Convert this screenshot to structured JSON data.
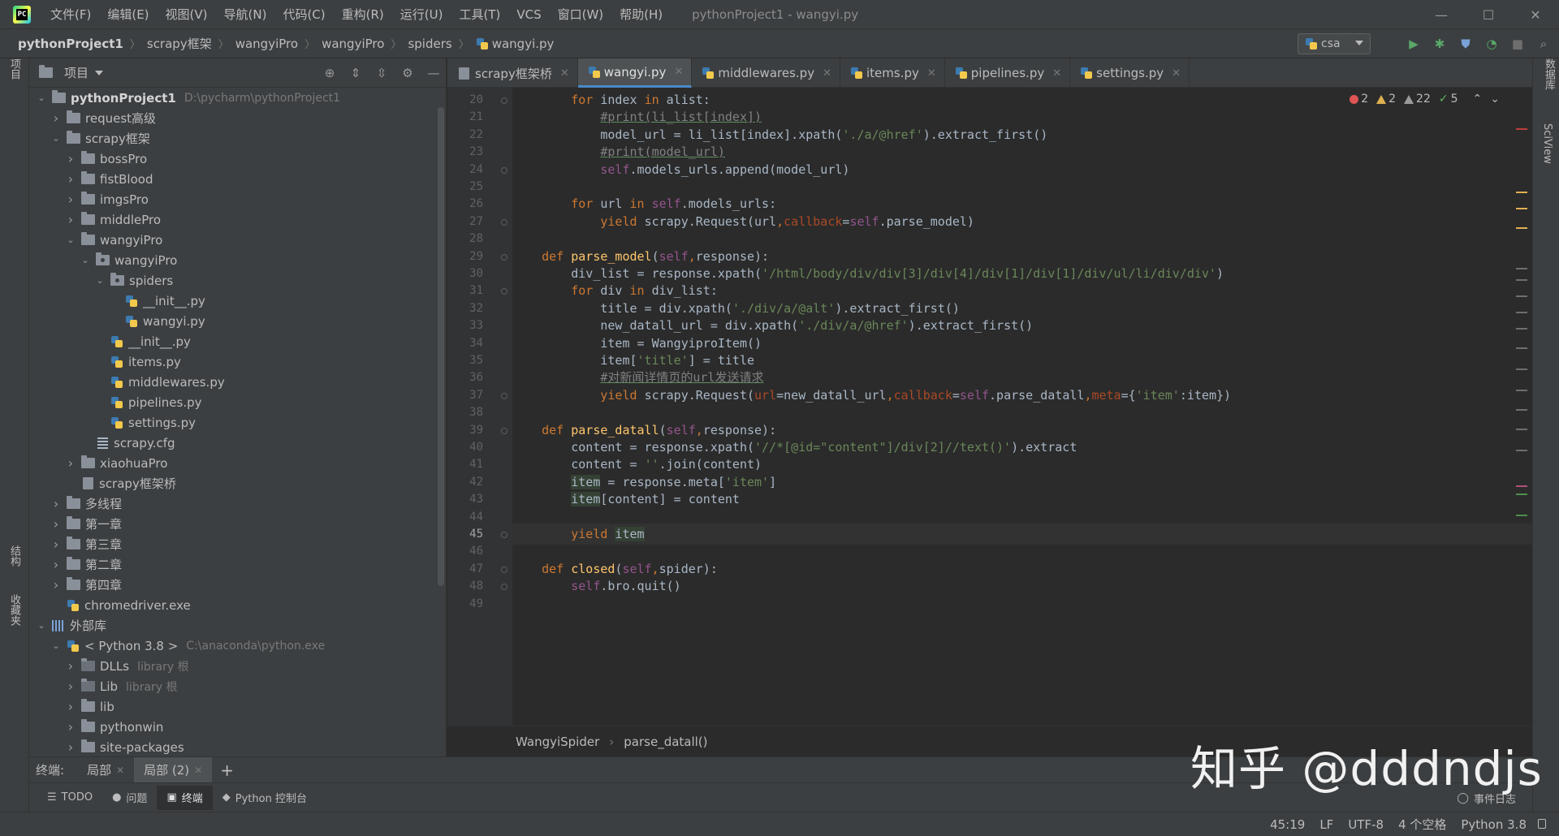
{
  "menubar": {
    "items": [
      "文件(F)",
      "编辑(E)",
      "视图(V)",
      "导航(N)",
      "代码(C)",
      "重构(R)",
      "运行(U)",
      "工具(T)",
      "VCS",
      "窗口(W)",
      "帮助(H)"
    ],
    "window_title": "pythonProject1 - wangyi.py"
  },
  "navbar": {
    "crumbs": [
      "pythonProject1",
      "scrapy框架",
      "wangyiPro",
      "wangyiPro",
      "spiders",
      "wangyi.py"
    ],
    "run_config": "csa"
  },
  "left_strip": {
    "project_tab": "项目",
    "structure_tab": "结构",
    "favorites_tab": "收藏夹"
  },
  "right_strip": {
    "database_tab": "数据库",
    "sciview_tab": "SciView"
  },
  "project_panel": {
    "title": "项目",
    "tree": [
      {
        "depth": 0,
        "arrow": "open",
        "icon": "folder",
        "label": "pythonProject1",
        "hint": "D:\\pycharm\\pythonProject1",
        "bold": true
      },
      {
        "depth": 1,
        "arrow": "closed",
        "icon": "folder",
        "label": "request高级"
      },
      {
        "depth": 1,
        "arrow": "open",
        "icon": "folder",
        "label": "scrapy框架"
      },
      {
        "depth": 2,
        "arrow": "closed",
        "icon": "folder",
        "label": "bossPro"
      },
      {
        "depth": 2,
        "arrow": "closed",
        "icon": "folder",
        "label": "fistBlood"
      },
      {
        "depth": 2,
        "arrow": "closed",
        "icon": "folder",
        "label": "imgsPro"
      },
      {
        "depth": 2,
        "arrow": "closed",
        "icon": "folder",
        "label": "middlePro"
      },
      {
        "depth": 2,
        "arrow": "open",
        "icon": "folder",
        "label": "wangyiPro"
      },
      {
        "depth": 3,
        "arrow": "open",
        "icon": "package",
        "label": "wangyiPro"
      },
      {
        "depth": 4,
        "arrow": "open",
        "icon": "package",
        "label": "spiders"
      },
      {
        "depth": 5,
        "arrow": "none",
        "icon": "python",
        "label": "__init__.py"
      },
      {
        "depth": 5,
        "arrow": "none",
        "icon": "python",
        "label": "wangyi.py"
      },
      {
        "depth": 4,
        "arrow": "none",
        "icon": "python",
        "label": "__init__.py"
      },
      {
        "depth": 4,
        "arrow": "none",
        "icon": "python",
        "label": "items.py"
      },
      {
        "depth": 4,
        "arrow": "none",
        "icon": "python",
        "label": "middlewares.py"
      },
      {
        "depth": 4,
        "arrow": "none",
        "icon": "python",
        "label": "pipelines.py"
      },
      {
        "depth": 4,
        "arrow": "none",
        "icon": "python",
        "label": "settings.py"
      },
      {
        "depth": 3,
        "arrow": "none",
        "icon": "config",
        "label": "scrapy.cfg"
      },
      {
        "depth": 2,
        "arrow": "closed",
        "icon": "folder",
        "label": "xiaohuaPro"
      },
      {
        "depth": 2,
        "arrow": "none",
        "icon": "file",
        "label": "scrapy框架桥"
      },
      {
        "depth": 1,
        "arrow": "closed",
        "icon": "folder",
        "label": "多线程"
      },
      {
        "depth": 1,
        "arrow": "closed",
        "icon": "folder",
        "label": "第一章"
      },
      {
        "depth": 1,
        "arrow": "closed",
        "icon": "folder",
        "label": "第三章"
      },
      {
        "depth": 1,
        "arrow": "closed",
        "icon": "folder",
        "label": "第二章"
      },
      {
        "depth": 1,
        "arrow": "closed",
        "icon": "folder",
        "label": "第四章"
      },
      {
        "depth": 1,
        "arrow": "none",
        "icon": "python",
        "label": "chromedriver.exe"
      },
      {
        "depth": 0,
        "arrow": "open",
        "icon": "library",
        "label": "外部库"
      },
      {
        "depth": 1,
        "arrow": "open",
        "icon": "python",
        "label": "< Python 3.8 >",
        "hint": "C:\\anaconda\\python.exe"
      },
      {
        "depth": 2,
        "arrow": "closed",
        "icon": "libfolder",
        "label": "DLLs",
        "hint": "library 根"
      },
      {
        "depth": 2,
        "arrow": "closed",
        "icon": "libfolder",
        "label": "Lib",
        "hint": "library 根"
      },
      {
        "depth": 2,
        "arrow": "closed",
        "icon": "folder",
        "label": "lib"
      },
      {
        "depth": 2,
        "arrow": "closed",
        "icon": "folder",
        "label": "pythonwin"
      },
      {
        "depth": 2,
        "arrow": "closed",
        "icon": "folder",
        "label": "site-packages"
      }
    ]
  },
  "editor": {
    "tabs": [
      {
        "label": "scrapy框架桥",
        "icon": "file",
        "active": false
      },
      {
        "label": "wangyi.py",
        "icon": "python",
        "active": true
      },
      {
        "label": "middlewares.py",
        "icon": "python",
        "active": false
      },
      {
        "label": "items.py",
        "icon": "python",
        "active": false
      },
      {
        "label": "pipelines.py",
        "icon": "python",
        "active": false
      },
      {
        "label": "settings.py",
        "icon": "python",
        "active": false
      }
    ],
    "inspections": {
      "errors": "2",
      "warnings": "2",
      "weak_warnings": "22",
      "ok": "5"
    },
    "current_line": 45,
    "lines": [
      {
        "n": 20,
        "tokens": [
          [
            "",
            "        "
          ],
          [
            "kw",
            "for "
          ],
          [
            "",
            "index "
          ],
          [
            "kw",
            "in "
          ],
          [
            "",
            "alist:"
          ]
        ]
      },
      {
        "n": 21,
        "tokens": [
          [
            "",
            "            "
          ],
          [
            "cm",
            "#print(li_list[index])"
          ]
        ]
      },
      {
        "n": 22,
        "tokens": [
          [
            "",
            "            model_url = li_list[index].xpath("
          ],
          [
            "st",
            "'./a/@href'"
          ],
          [
            "",
            ").extract_first()"
          ]
        ]
      },
      {
        "n": 23,
        "tokens": [
          [
            "",
            "            "
          ],
          [
            "cm",
            "#print(model_url)"
          ]
        ]
      },
      {
        "n": 24,
        "tokens": [
          [
            "",
            "            "
          ],
          [
            "se",
            "self"
          ],
          [
            "",
            ".models_urls.append(model_url)"
          ]
        ]
      },
      {
        "n": 25,
        "tokens": [
          [
            "",
            ""
          ]
        ]
      },
      {
        "n": 26,
        "tokens": [
          [
            "",
            "        "
          ],
          [
            "kw",
            "for "
          ],
          [
            "",
            "url "
          ],
          [
            "kw",
            "in "
          ],
          [
            "se",
            "self"
          ],
          [
            "",
            ".models_urls:"
          ]
        ]
      },
      {
        "n": 27,
        "tokens": [
          [
            "",
            "            "
          ],
          [
            "kw",
            "yield "
          ],
          [
            "",
            "scrapy.Request(url"
          ],
          [
            "kw",
            ","
          ],
          [
            "pa",
            "callback"
          ],
          [
            "",
            "="
          ],
          [
            "se",
            "self"
          ],
          [
            "",
            ".parse_model)"
          ]
        ]
      },
      {
        "n": 28,
        "tokens": [
          [
            "",
            ""
          ]
        ]
      },
      {
        "n": 29,
        "tokens": [
          [
            "",
            "    "
          ],
          [
            "kw",
            "def "
          ],
          [
            "fn",
            "parse_model"
          ],
          [
            "",
            "("
          ],
          [
            "se",
            "self"
          ],
          [
            "kw",
            ","
          ],
          [
            "",
            "response):"
          ]
        ]
      },
      {
        "n": 30,
        "tokens": [
          [
            "",
            "        div_list = response.xpath("
          ],
          [
            "st",
            "'/html/body/div/div[3]/div[4]/div[1]/div[1]/div/ul/li/div/div'"
          ],
          [
            "",
            ")"
          ]
        ]
      },
      {
        "n": 31,
        "tokens": [
          [
            "",
            "        "
          ],
          [
            "kw",
            "for "
          ],
          [
            "",
            "div "
          ],
          [
            "kw",
            "in "
          ],
          [
            "",
            "div_list:"
          ]
        ]
      },
      {
        "n": 32,
        "tokens": [
          [
            "",
            "            title = div.xpath("
          ],
          [
            "st",
            "'./div/a/@alt'"
          ],
          [
            "",
            ").extract_first()"
          ]
        ]
      },
      {
        "n": 33,
        "tokens": [
          [
            "",
            "            new_datall_url = div.xpath("
          ],
          [
            "st",
            "'./div/a/@href'"
          ],
          [
            "",
            ").extract_first()"
          ]
        ]
      },
      {
        "n": 34,
        "tokens": [
          [
            "",
            "            item = WangyiproItem()"
          ]
        ]
      },
      {
        "n": 35,
        "tokens": [
          [
            "",
            "            item["
          ],
          [
            "st",
            "'title'"
          ],
          [
            "",
            "] = title"
          ]
        ]
      },
      {
        "n": 36,
        "tokens": [
          [
            "",
            "            "
          ],
          [
            "cm",
            "#对新闻详情页的url发送请求"
          ]
        ]
      },
      {
        "n": 37,
        "tokens": [
          [
            "",
            "            "
          ],
          [
            "kw",
            "yield "
          ],
          [
            "",
            "scrapy.Request("
          ],
          [
            "pa",
            "url"
          ],
          [
            "",
            "=new_datall_url"
          ],
          [
            "kw",
            ","
          ],
          [
            "pa",
            "callback"
          ],
          [
            "",
            "="
          ],
          [
            "se",
            "self"
          ],
          [
            "",
            ".parse_datall"
          ],
          [
            "kw",
            ","
          ],
          [
            "pa",
            "meta"
          ],
          [
            "",
            "={"
          ],
          [
            "st",
            "'item'"
          ],
          [
            "",
            ":item})"
          ]
        ]
      },
      {
        "n": 38,
        "tokens": [
          [
            "",
            ""
          ]
        ]
      },
      {
        "n": 39,
        "tokens": [
          [
            "",
            "    "
          ],
          [
            "kw",
            "def "
          ],
          [
            "fn",
            "parse_datall"
          ],
          [
            "",
            "("
          ],
          [
            "se",
            "self"
          ],
          [
            "kw",
            ","
          ],
          [
            "",
            "response):"
          ]
        ]
      },
      {
        "n": 40,
        "tokens": [
          [
            "",
            "        content = response.xpath("
          ],
          [
            "st",
            "'//*[@id=\"content\"]/div[2]//text()'"
          ],
          [
            "",
            ").extract"
          ]
        ]
      },
      {
        "n": 41,
        "tokens": [
          [
            "",
            "        content = "
          ],
          [
            "st",
            "''"
          ],
          [
            "",
            ".join(content)"
          ]
        ]
      },
      {
        "n": 42,
        "tokens": [
          [
            "",
            "        "
          ],
          [
            "hl",
            "item"
          ],
          [
            "",
            " = response.meta["
          ],
          [
            "st",
            "'item'"
          ],
          [
            "",
            "]"
          ]
        ]
      },
      {
        "n": 43,
        "tokens": [
          [
            "",
            "        "
          ],
          [
            "hl",
            "item"
          ],
          [
            "",
            "[content] = content"
          ]
        ]
      },
      {
        "n": 44,
        "tokens": [
          [
            "",
            ""
          ]
        ]
      },
      {
        "n": 45,
        "tokens": [
          [
            "",
            "        "
          ],
          [
            "kw",
            "yield "
          ],
          [
            "hl",
            "item"
          ]
        ]
      },
      {
        "n": 46,
        "tokens": [
          [
            "",
            ""
          ]
        ]
      },
      {
        "n": 47,
        "tokens": [
          [
            "",
            "    "
          ],
          [
            "kw",
            "def "
          ],
          [
            "fn",
            "closed"
          ],
          [
            "",
            "("
          ],
          [
            "se",
            "self"
          ],
          [
            "kw",
            ","
          ],
          [
            "",
            "spider):"
          ]
        ]
      },
      {
        "n": 48,
        "tokens": [
          [
            "",
            "        "
          ],
          [
            "se",
            "self"
          ],
          [
            "",
            ".bro.quit()"
          ]
        ]
      },
      {
        "n": 49,
        "tokens": [
          [
            "",
            ""
          ]
        ]
      }
    ],
    "fold_lines": [
      20,
      24,
      27,
      29,
      31,
      37,
      39,
      45,
      47,
      48
    ],
    "breadcrumb": [
      "WangyiSpider",
      "parse_datall()"
    ]
  },
  "terminal": {
    "label": "终端:",
    "tabs": [
      {
        "label": "局部",
        "active": false
      },
      {
        "label": "局部 (2)",
        "active": true
      }
    ]
  },
  "tool_windows": {
    "items": [
      {
        "label": "TODO",
        "active": false
      },
      {
        "label": "问题",
        "active": false
      },
      {
        "label": "终端",
        "active": true
      },
      {
        "label": "Python 控制台",
        "active": false
      }
    ],
    "event_log": "事件日志"
  },
  "statusbar": {
    "position": "45:19",
    "line_sep": "LF",
    "encoding": "UTF-8",
    "indent": "4 个空格",
    "interpreter": "Python 3.8"
  },
  "watermark": "知乎 @dddndjs",
  "colors": {
    "accent": "#4a88c7",
    "error": "#e05555",
    "warning": "#e0b050",
    "ok": "#5fb85f"
  }
}
